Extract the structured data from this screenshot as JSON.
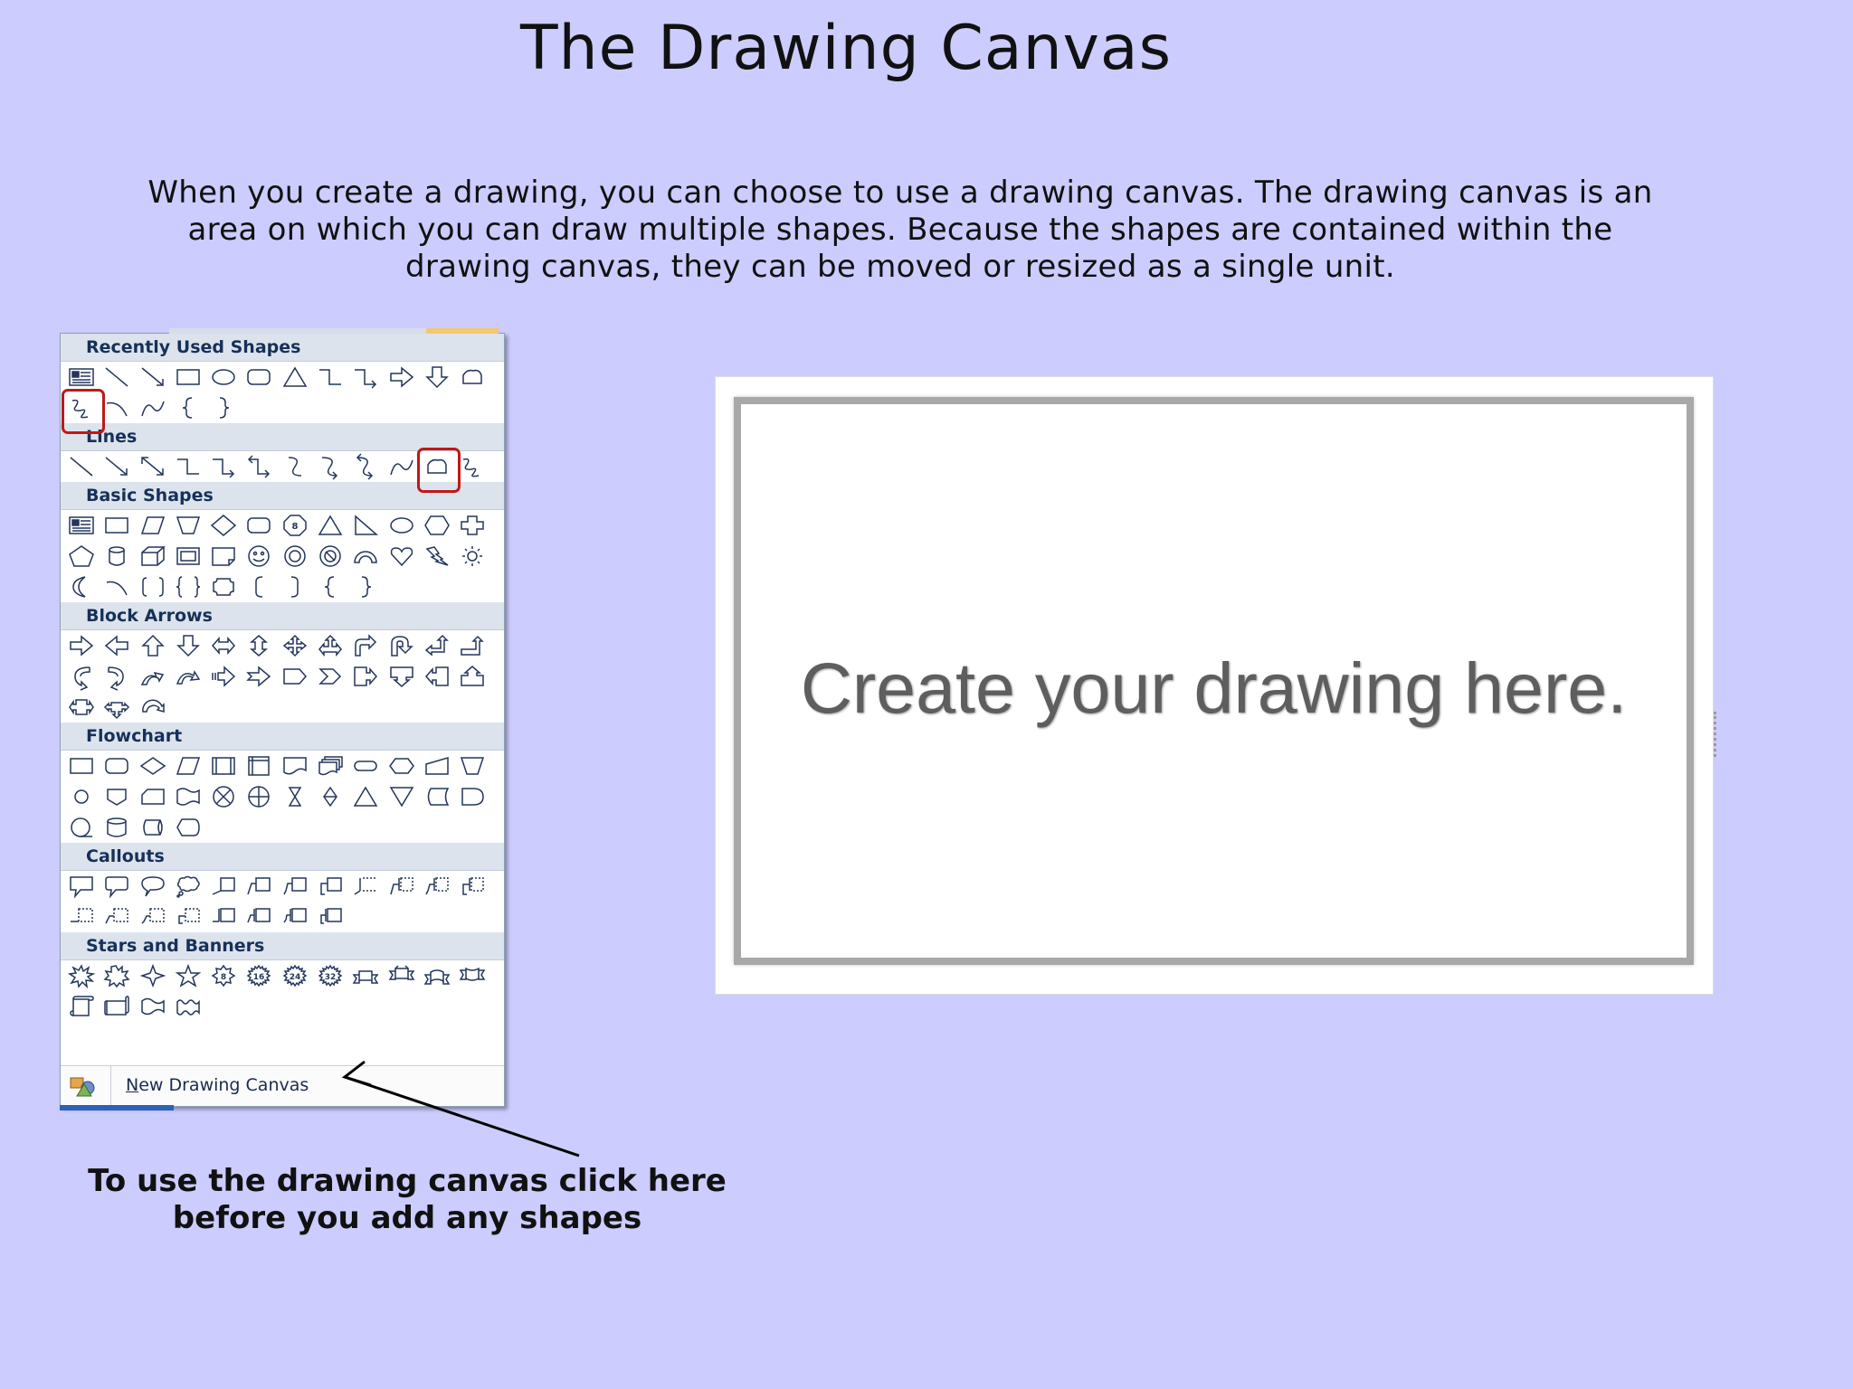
{
  "title": "The Drawing Canvas",
  "intro": "When you create a drawing, you can choose to use a drawing canvas. The drawing canvas is an area on which you can draw multiple shapes. Because the shapes are contained within the drawing canvas, they can be moved or resized as a single unit.",
  "shapes_menu": {
    "sections": [
      {
        "header": "Recently Used Shapes",
        "rows": [
          [
            "textbox-icon",
            "line-icon",
            "arrow-line-icon",
            "rectangle-icon",
            "oval-icon",
            "rounded-rectangle-icon",
            "triangle-icon",
            "elbow-connector-icon",
            "elbow-arrow-connector-icon",
            "right-arrow-icon",
            "down-arrow-icon",
            "freeform-icon"
          ],
          [
            "scribble-icon",
            "arc-icon",
            "curve-icon",
            "left-brace-icon",
            "right-brace-icon"
          ]
        ]
      },
      {
        "header": "Lines",
        "rows": [
          [
            "line-icon",
            "arrow-line-icon",
            "double-arrow-line-icon",
            "elbow-connector-icon",
            "elbow-arrow-connector-icon",
            "elbow-double-arrow-connector-icon",
            "curved-connector-icon",
            "curved-arrow-connector-icon",
            "curved-double-arrow-connector-icon",
            "curve-icon",
            "freeform-icon",
            "scribble-icon"
          ]
        ]
      },
      {
        "header": "Basic Shapes",
        "rows": [
          [
            "textbox-icon",
            "rectangle-icon",
            "parallelogram-icon",
            "trapezoid-icon",
            "diamond-icon",
            "rounded-rectangle-icon",
            "octagon-icon",
            "triangle-icon",
            "right-triangle-icon",
            "oval-icon",
            "hexagon-icon",
            "cross-icon"
          ],
          [
            "pentagon-icon",
            "can-icon",
            "cube-icon",
            "bevel-icon",
            "folded-corner-icon",
            "smiley-face-icon",
            "donut-icon",
            "no-symbol-icon",
            "block-arc-icon",
            "heart-icon",
            "lightning-bolt-icon",
            "sun-icon"
          ],
          [
            "moon-icon",
            "arc-icon",
            "double-bracket-icon",
            "double-brace-icon",
            "plaque-icon",
            "left-bracket-icon",
            "right-bracket-icon",
            "left-brace-icon",
            "right-brace-icon"
          ]
        ]
      },
      {
        "header": "Block Arrows",
        "rows": [
          [
            "right-arrow-icon",
            "left-arrow-icon",
            "up-arrow-icon",
            "down-arrow-icon",
            "left-right-arrow-icon",
            "up-down-arrow-icon",
            "quad-arrow-icon",
            "left-right-up-arrow-icon",
            "bent-arrow-icon",
            "u-turn-arrow-icon",
            "left-up-arrow-icon",
            "bent-up-arrow-icon"
          ],
          [
            "curved-right-arrow-icon",
            "curved-left-arrow-icon",
            "curved-up-arrow-icon",
            "curved-down-arrow-icon",
            "striped-right-arrow-icon",
            "notched-right-arrow-icon",
            "pentagon-arrow-icon",
            "chevron-icon",
            "right-arrow-callout-icon",
            "down-arrow-callout-icon",
            "left-arrow-callout-icon",
            "up-arrow-callout-icon"
          ],
          [
            "left-right-arrow-callout-icon",
            "quad-arrow-callout-icon",
            "circular-arrow-icon"
          ]
        ]
      },
      {
        "header": "Flowchart",
        "rows": [
          [
            "process-icon",
            "alternate-process-icon",
            "decision-icon",
            "data-icon",
            "predefined-process-icon",
            "internal-storage-icon",
            "document-icon",
            "multidocument-icon",
            "terminator-icon",
            "preparation-icon",
            "manual-input-icon",
            "manual-operation-icon"
          ],
          [
            "connector-icon",
            "off-page-connector-icon",
            "card-icon",
            "punched-tape-icon",
            "summing-junction-icon",
            "or-icon",
            "collate-icon",
            "sort-icon",
            "extract-icon",
            "merge-icon",
            "stored-data-icon",
            "delay-icon"
          ],
          [
            "sequential-access-storage-icon",
            "magnetic-disk-icon",
            "direct-access-storage-icon",
            "display-icon"
          ]
        ]
      },
      {
        "header": "Callouts",
        "rows": [
          [
            "rectangular-callout-icon",
            "rounded-rectangular-callout-icon",
            "oval-callout-icon",
            "cloud-callout-icon",
            "line-callout-1-icon",
            "line-callout-2-icon",
            "line-callout-3-icon",
            "line-callout-4-icon",
            "line-callout-1-accent-icon",
            "line-callout-2-accent-icon",
            "line-callout-3-accent-icon",
            "line-callout-4-accent-icon"
          ],
          [
            "line-callout-1-no-border-icon",
            "line-callout-2-no-border-icon",
            "line-callout-3-no-border-icon",
            "line-callout-4-no-border-icon",
            "line-callout-1-border-accent-icon",
            "line-callout-2-border-accent-icon",
            "line-callout-3-border-accent-icon",
            "line-callout-4-border-accent-icon"
          ]
        ]
      },
      {
        "header": "Stars and Banners",
        "rows": [
          [
            "explosion-1-icon",
            "explosion-2-icon",
            "4-point-star-icon",
            "5-point-star-icon",
            "8-point-star-icon",
            "16-point-star-icon",
            "24-point-star-icon",
            "32-point-star-icon",
            "up-ribbon-icon",
            "down-ribbon-icon",
            "curved-up-ribbon-icon",
            "curved-down-ribbon-icon"
          ],
          [
            "vertical-scroll-icon",
            "horizontal-scroll-icon",
            "wave-icon",
            "double-wave-icon"
          ]
        ]
      }
    ],
    "star_numbers": {
      "8-point-star-icon": "8",
      "16-point-star-icon": "16",
      "24-point-star-icon": "24",
      "32-point-star-icon": "32"
    },
    "octagon_label": "8",
    "highlighted": [
      "scribble-icon-recent",
      "freeform-icon-lines"
    ],
    "footer": {
      "accel": "N",
      "label_rest": "ew Drawing Canvas",
      "icon": "drawing-canvas-icon"
    }
  },
  "canvas": {
    "placeholder": "Create your drawing here."
  },
  "instruction": "To use the drawing canvas click here before you add any shapes",
  "colors": {
    "background": "#ccccff",
    "highlight": "#c01818",
    "menu_header_text": "#15315a",
    "icon_stroke": "#24365c"
  }
}
